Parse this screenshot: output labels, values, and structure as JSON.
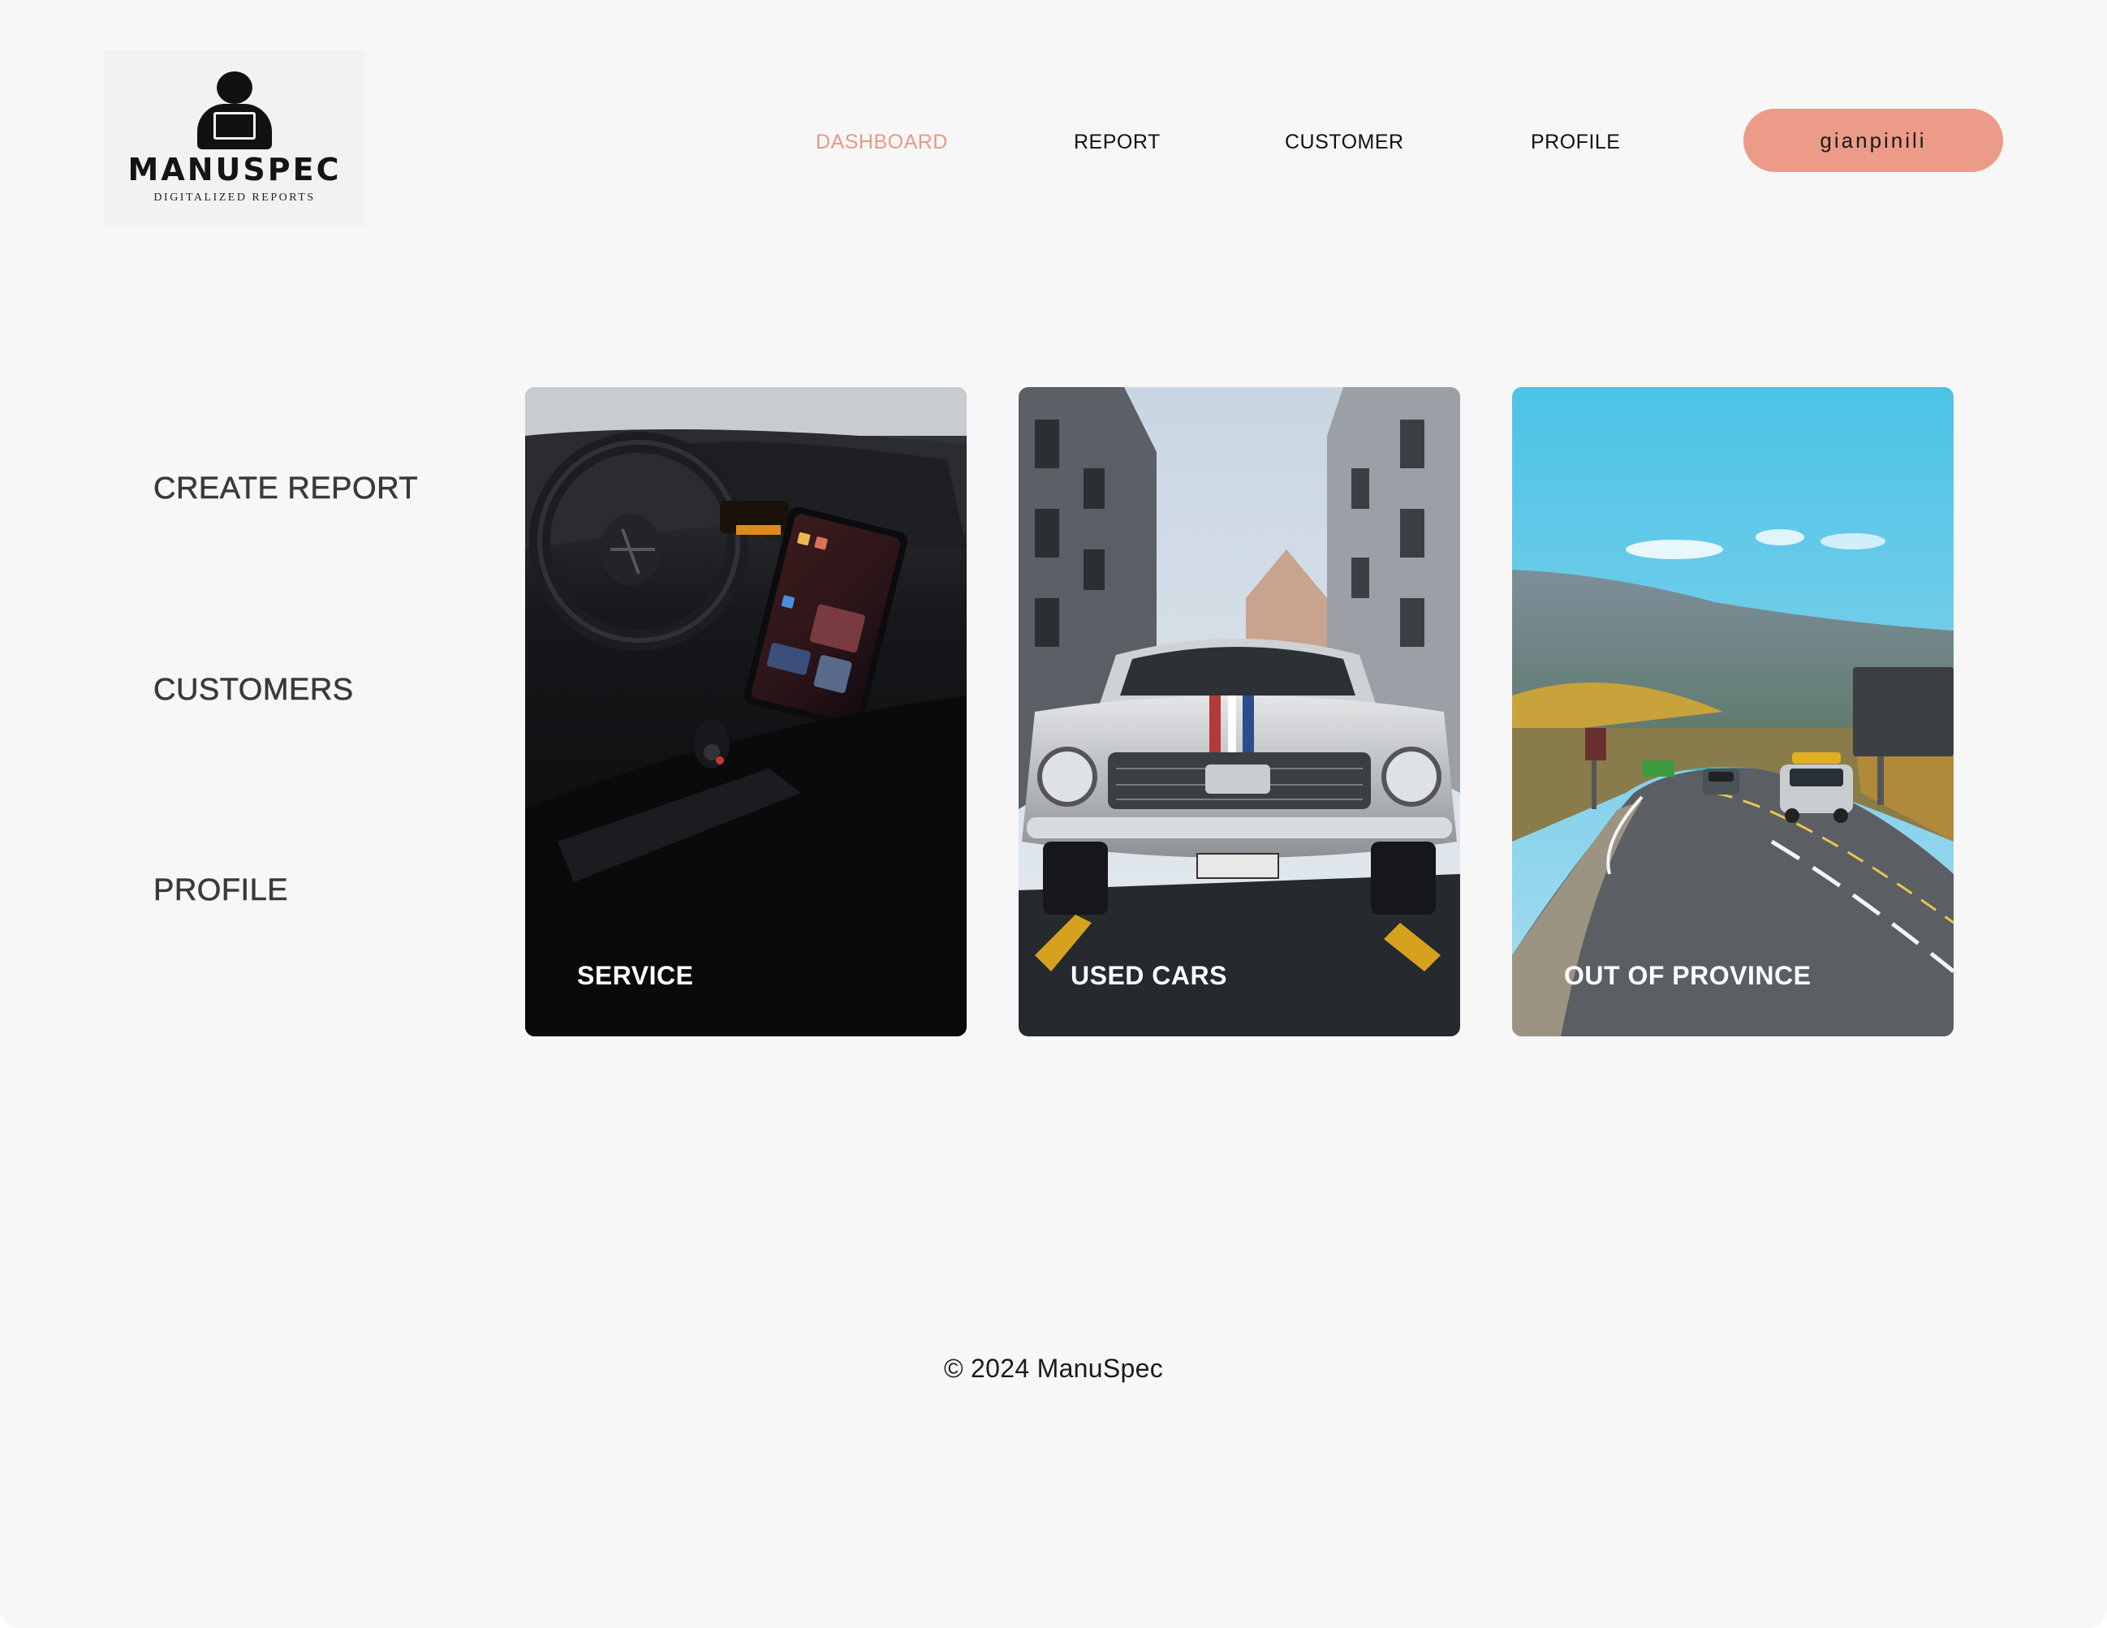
{
  "brand": {
    "title": "MANUSPEC",
    "subtitle": "DIGITALIZED REPORTS",
    "logo_icon": "person-at-laptop-icon"
  },
  "nav": {
    "items": [
      {
        "label": "DASHBOARD",
        "active": true
      },
      {
        "label": "REPORT",
        "active": false
      },
      {
        "label": "CUSTOMER",
        "active": false
      },
      {
        "label": "PROFILE",
        "active": false
      }
    ],
    "user_button": "gianpinili"
  },
  "sidebar": {
    "items": [
      {
        "label": "CREATE REPORT"
      },
      {
        "label": "CUSTOMERS"
      },
      {
        "label": "PROFILE"
      }
    ]
  },
  "cards": [
    {
      "label": "SERVICE",
      "image": "car-interior-dashboard-image"
    },
    {
      "label": "USED CARS",
      "image": "vintage-mustang-street-image"
    },
    {
      "label": "OUT OF PROVINCE",
      "image": "mountain-highway-road-image"
    }
  ],
  "footer": {
    "text": "© 2024 ManuSpec"
  },
  "colors": {
    "accent": "#ec9b88",
    "active_nav": "#e79a86",
    "background": "#f7f7f7"
  }
}
